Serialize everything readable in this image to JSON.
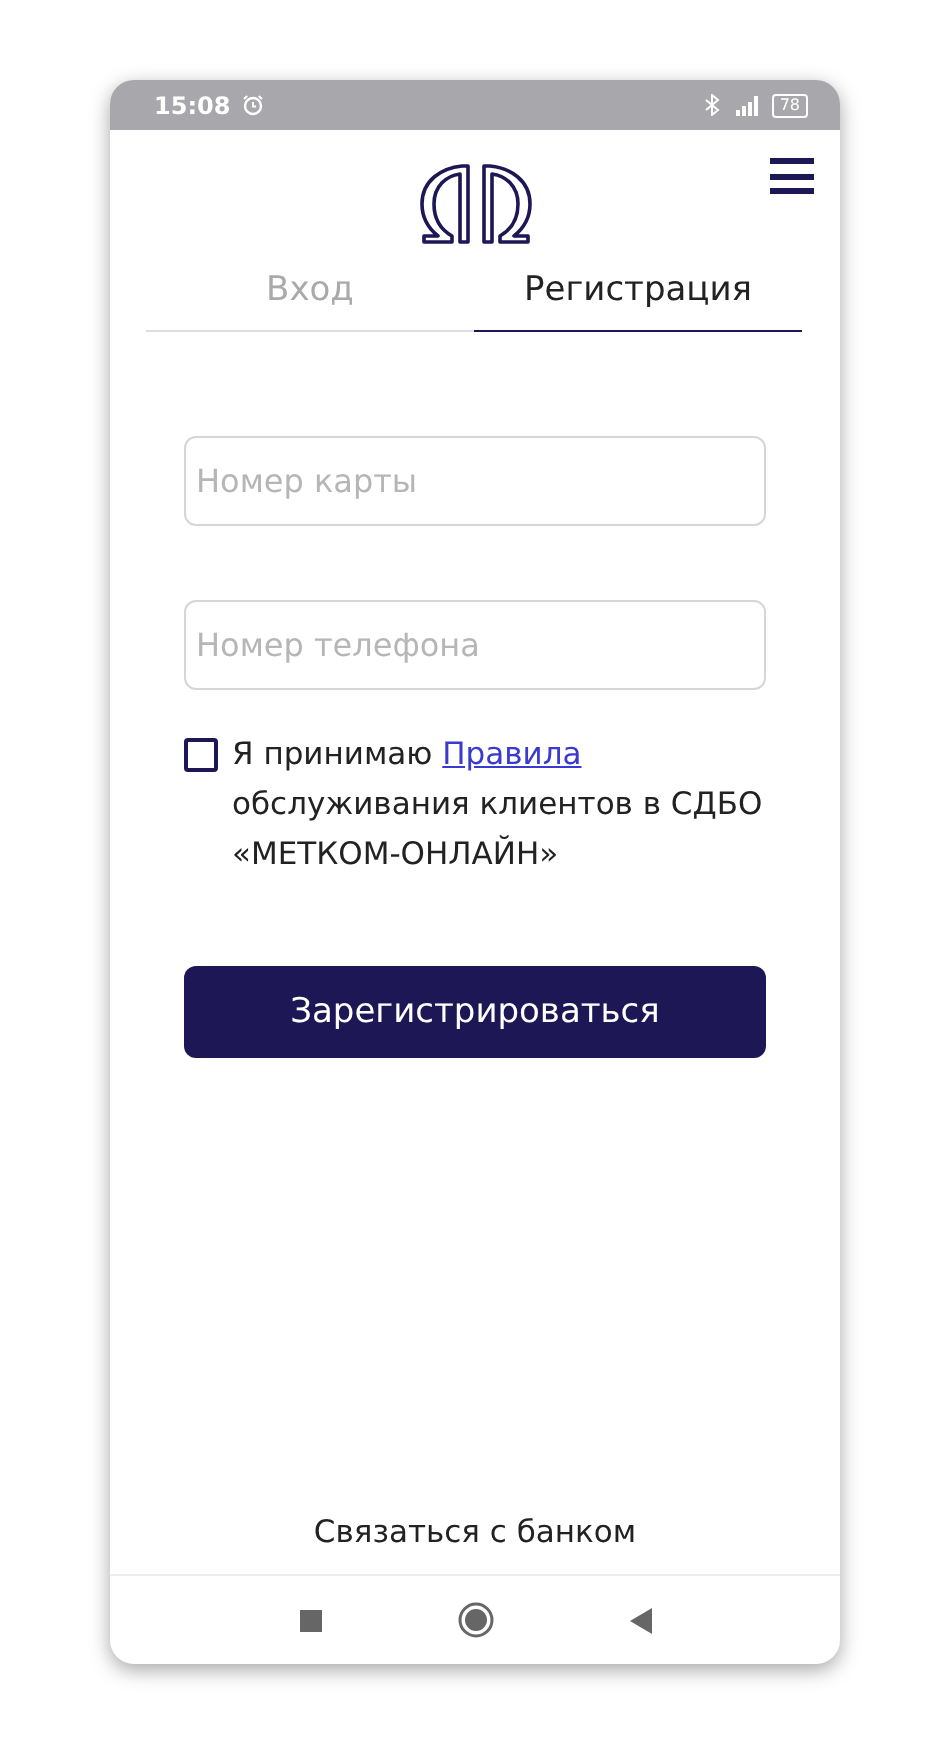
{
  "status_bar": {
    "time": "15:08",
    "battery": "78"
  },
  "tabs": [
    {
      "label": "Вход",
      "selected": false
    },
    {
      "label": "Регистрация",
      "selected": true
    }
  ],
  "fields": [
    {
      "placeholder": "Номер карты"
    },
    {
      "placeholder": "Номер телефона"
    }
  ],
  "agreement": {
    "checked": false,
    "text_before": "Я принимаю",
    "link": "Правила",
    "text_after": "обслуживания клиентов в СДБО «МЕТКОМ-ОНЛАЙН»"
  },
  "register_button": "Зарегистрироваться",
  "contact_link": "Связаться с банком"
}
